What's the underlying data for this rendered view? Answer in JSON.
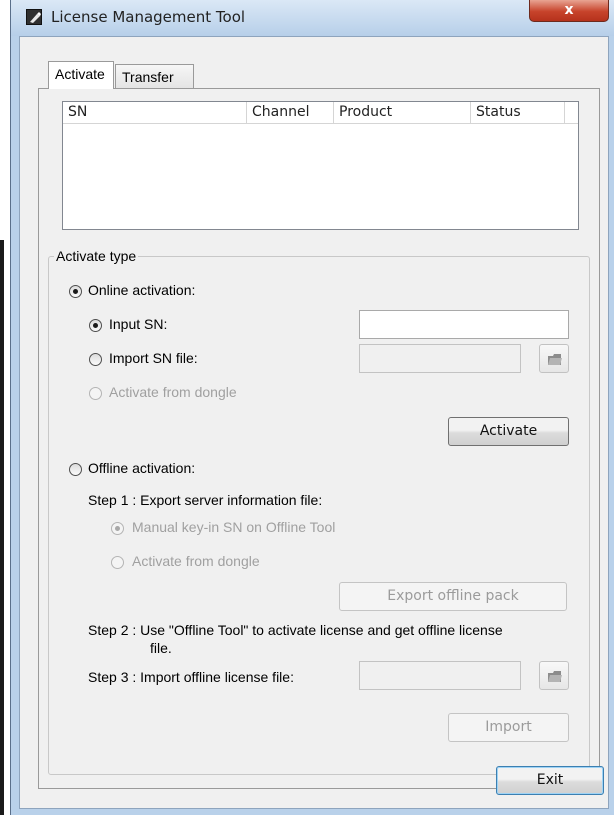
{
  "window": {
    "title": "License Management Tool",
    "close_label": "x"
  },
  "tabs": [
    {
      "label": "Activate",
      "selected": true
    },
    {
      "label": "Transfer",
      "selected": false
    }
  ],
  "license_list": {
    "columns": [
      "SN",
      "Channel",
      "Product",
      "Status"
    ],
    "rows": []
  },
  "activate_type": {
    "legend": "Activate type",
    "online": {
      "label": "Online activation:",
      "selected": true,
      "input_sn": {
        "label": "Input SN:",
        "selected": true,
        "value": ""
      },
      "import_sn_file": {
        "label": "Import SN file:",
        "selected": false,
        "value": ""
      },
      "activate_from_dongle": {
        "label": "Activate from dongle",
        "enabled": false
      },
      "activate_button": "Activate"
    },
    "offline": {
      "label": "Offline activation:",
      "selected": false,
      "step1": "Step 1 : Export server information file:",
      "manual_keyin": {
        "label": "Manual key-in SN on Offline Tool",
        "selected": true,
        "enabled": false
      },
      "activate_from_dongle": {
        "label": "Activate from dongle",
        "enabled": false
      },
      "export_button": "Export offline pack",
      "step2_line1": "Step 2 : Use \"Offline Tool\" to activate license and get offline license",
      "step2_line2": "file.",
      "step3": "Step 3 : Import offline license file:",
      "import_file_value": "",
      "import_button": "Import"
    }
  },
  "exit_button": "Exit",
  "colors": {
    "window_frame": "#b9d1ea",
    "close_button": "#c7432b",
    "dialog_bg": "#f0f0f0",
    "default_button_border": "#3c7fb1"
  }
}
